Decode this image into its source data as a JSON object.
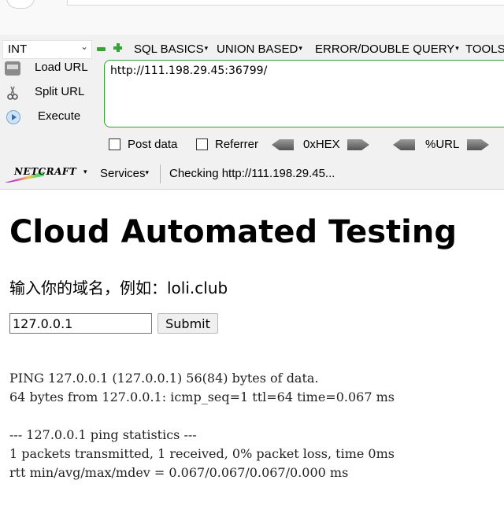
{
  "hackbar": {
    "type_select": "INT",
    "menu": [
      {
        "label": "SQL BASICS"
      },
      {
        "label": "UNION BASED"
      },
      {
        "label": "ERROR/DOUBLE QUERY"
      },
      {
        "label": "TOOLS"
      }
    ],
    "load_url": "Load URL",
    "split_url": "Split URL",
    "execute": "Execute",
    "url_value": "http://111.198.29.45:36799/",
    "post_data": "Post data",
    "referrer": "Referrer",
    "hex": "0xHEX",
    "urlenc": "%URL",
    "netcraft": "NETCRAFT",
    "services": "Services",
    "checking": "Checking http://111.198.29.45..."
  },
  "page": {
    "title": "Cloud Automated Testing",
    "hint": "输入你的域名，例如：loli.club",
    "input_value": "127.0.0.1",
    "submit": "Submit",
    "output": "PING 127.0.0.1 (127.0.0.1) 56(84) bytes of data.\n64 bytes from 127.0.0.1: icmp_seq=1 ttl=64 time=0.067 ms\n\n--- 127.0.0.1 ping statistics ---\n1 packets transmitted, 1 received, 0% packet loss, time 0ms\nrtt min/avg/max/mdev = 0.067/0.067/0.067/0.000 ms"
  }
}
